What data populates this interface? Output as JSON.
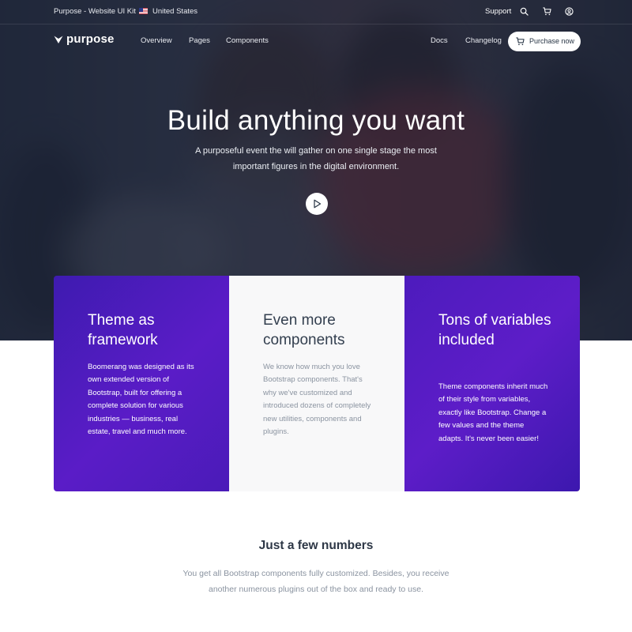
{
  "topbar": {
    "brand": "Purpose - Website UI Kit",
    "country": "United States",
    "support": "Support"
  },
  "nav": {
    "logo": "purpose",
    "links": [
      "Overview",
      "Pages",
      "Components"
    ],
    "right_links": [
      "Docs",
      "Changelog"
    ],
    "purchase": "Purchase now"
  },
  "hero": {
    "title": "Build anything you want",
    "subtitle": "A purposeful event the will gather on one single stage the most important figures in the digital environment."
  },
  "cards": [
    {
      "title": "Theme as framework",
      "text": "Boomerang was designed as its own extended version of Bootstrap, built for offering a complete solution for various industries — business, real estate, travel and much more."
    },
    {
      "title": "Even more components",
      "text": "We know how much you love Bootstrap components. That's why we've customized and introduced dozens of completely new utilities, components and plugins."
    },
    {
      "title": "Tons of variables included",
      "text": "Theme components inherit much of their style from variables, exactly like Bootstrap. Change a few values and the theme adapts. It's never been easier!"
    }
  ],
  "numbers": {
    "title": "Just a few numbers",
    "subtitle": "You get all Bootstrap components fully customized. Besides, you receive another numerous plugins out of the box and ready to use."
  },
  "icons": [
    "flag-us-icon",
    "search-icon",
    "cart-icon",
    "user-circle-icon",
    "logo-icon",
    "play-icon"
  ],
  "colors": {
    "accent": "#5a1cc7",
    "hero_overlay": "#181e30",
    "heading": "#2d3746",
    "muted": "#8a93a0"
  }
}
